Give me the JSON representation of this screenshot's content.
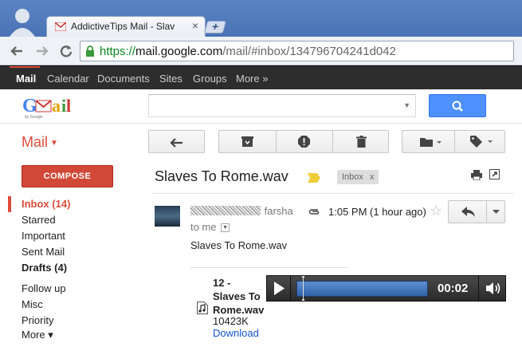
{
  "browser": {
    "tab_title": "AddictiveTips Mail - Slaves",
    "tab_close": "×",
    "new_tab": "+",
    "back": "←",
    "forward": "→",
    "reload": "C",
    "url_scheme": "https://",
    "url_host": "mail.google.com",
    "url_path": "/mail/#inbox/134796704241d042"
  },
  "gbar": {
    "items": [
      "Mail",
      "Calendar",
      "Documents",
      "Sites",
      "Groups",
      "More »"
    ]
  },
  "logo_text": "Gmail",
  "logo_sub": "by Google",
  "mail_menu": "Mail",
  "compose_label": "COMPOSE",
  "nav": {
    "inbox": "Inbox (14)",
    "starred": "Starred",
    "important": "Important",
    "sent": "Sent Mail",
    "drafts": "Drafts (4)",
    "followup": "Follow up",
    "misc": "Misc",
    "priority": "Priority",
    "more": "More ▾"
  },
  "message": {
    "subject": "Slaves To Rome.wav",
    "label": "Inbox",
    "label_remove": "x",
    "sender_name": "farsha",
    "to": "to me",
    "time": "1:05 PM (1 hour ago)",
    "star": "☆",
    "body": "Slaves To Rome.wav",
    "attachment": {
      "name_line1": "12 -",
      "name_line2": "Slaves To",
      "name_line3": "Rome.wav",
      "size": "10423K",
      "download": "Download"
    }
  },
  "player": {
    "elapsed": "00:02",
    "progress": 0.04
  },
  "colors": {
    "brand_red": "#dd4b39",
    "search_blue": "#4d90fe",
    "link_blue": "#1155cc"
  }
}
